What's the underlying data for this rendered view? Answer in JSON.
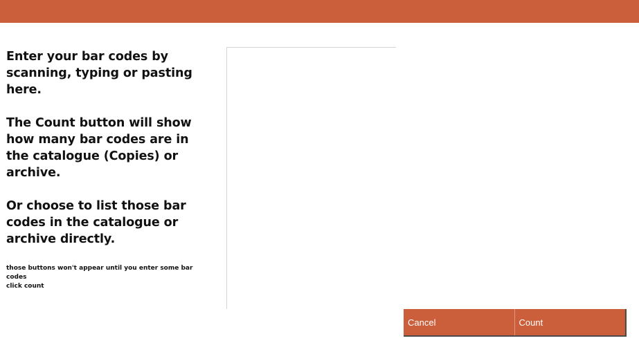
{
  "header": {
    "color": "#cb5e3b"
  },
  "instructions": {
    "paragraphs": [
      "Enter your bar codes by scanning, typing or pasting here.",
      "The Count button will show how many bar codes are in the catalogue (Copies) or archive.",
      "Or choose to list those bar codes in the catalogue or archive directly."
    ],
    "note_lines": [
      "those buttons won't appear until you enter some bar codes",
      "click count"
    ]
  },
  "barcode_input": {
    "value": "",
    "placeholder": ""
  },
  "buttons": {
    "cancel_label": "Cancel",
    "count_label": "Count",
    "color": "#cb5e3b"
  }
}
